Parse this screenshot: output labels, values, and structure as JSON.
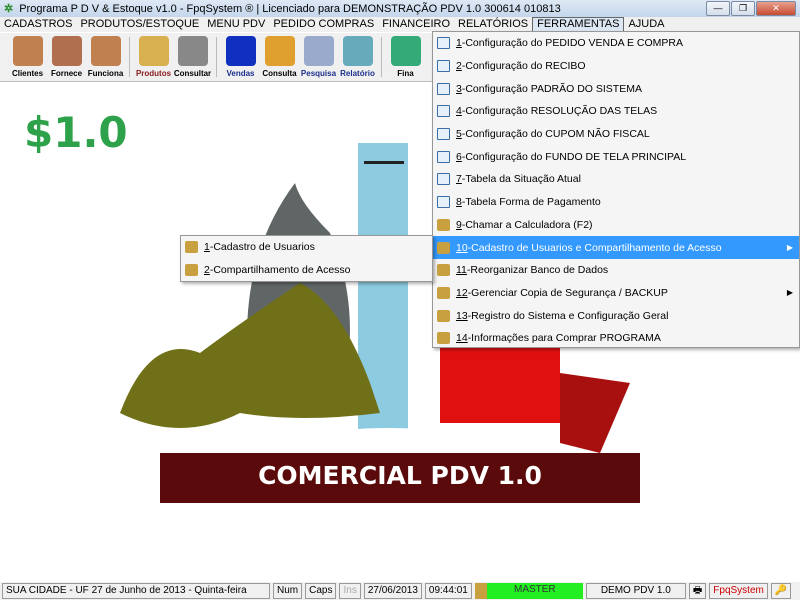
{
  "title": "Programa P D V & Estoque v1.0 - FpqSystem ® | Licenciado para  DEMONSTRAÇÃO PDV 1.0 300614 010813",
  "menubar": [
    "CADASTROS",
    "PRODUTOS/ESTOQUE",
    "MENU PDV",
    "PEDIDO COMPRAS",
    "FINANCEIRO",
    "RELATÓRIOS",
    "FERRAMENTAS",
    "AJUDA"
  ],
  "toolbar": [
    {
      "label": "Clientes",
      "icon": "clients-icon",
      "color": "#000"
    },
    {
      "label": "Fornece",
      "icon": "supplier-icon",
      "color": "#000"
    },
    {
      "label": "Funciona",
      "icon": "employee-icon",
      "color": "#000"
    },
    {
      "label": "Produtos",
      "icon": "boxes-icon",
      "color": "#8b1a1a"
    },
    {
      "label": "Consultar",
      "icon": "barcode-icon",
      "color": "#000"
    },
    {
      "label": "Vendas",
      "icon": "pdv-icon",
      "color": "#1a2f8b"
    },
    {
      "label": "Consulta",
      "icon": "drawer-icon",
      "color": "#000"
    },
    {
      "label": "Pesquisa",
      "icon": "search-icon",
      "color": "#1a2f8b"
    },
    {
      "label": "Relatório",
      "icon": "printer-icon",
      "color": "#1a2f8b"
    },
    {
      "label": "Fina",
      "icon": "money-icon",
      "color": "#000"
    }
  ],
  "logo": {
    "price": "$1.0",
    "caption": "COMERCIAL PDV 1.0"
  },
  "ferramentas_menu": [
    {
      "key": "1",
      "label": "-Configuração do PEDIDO VENDA E COMPRA"
    },
    {
      "key": "2",
      "label": "-Configuração do RECIBO"
    },
    {
      "key": "3",
      "label": "-Configuração PADRÃO DO SISTEMA"
    },
    {
      "key": "4",
      "label": "-Configuração RESOLUÇÃO DAS TELAS"
    },
    {
      "key": "5",
      "label": "-Configuração do CUPOM NÃO FISCAL"
    },
    {
      "key": "6",
      "label": "-Configuração do FUNDO DE TELA PRINCIPAL"
    },
    {
      "key": "7",
      "label": "-Tabela da Situação Atual"
    },
    {
      "key": "8",
      "label": "-Tabela Forma de Pagamento"
    },
    {
      "key": "9",
      "label": "-Chamar a Calculadora (F2)"
    },
    {
      "key": "10",
      "label": "-Cadastro de Usuarios e Compartilhamento de Acesso",
      "submenu": true,
      "highlighted": true
    },
    {
      "key": "11",
      "label": "-Reorganizar Banco de Dados"
    },
    {
      "key": "12",
      "label": "-Gerenciar Copia de Segurança / BACKUP",
      "submenu": true
    },
    {
      "key": "13",
      "label": "-Registro do Sistema e Configuração Geral"
    },
    {
      "key": "14",
      "label": "-Informações para Comprar PROGRAMA"
    }
  ],
  "submenu": [
    {
      "key": "1",
      "label": "-Cadastro de Usuarios"
    },
    {
      "key": "2",
      "label": "-Compartilhamento de Acesso"
    }
  ],
  "status": {
    "city": "SUA CIDADE - UF 27 de Junho de 2013 - Quinta-feira",
    "num": "Num",
    "caps": "Caps",
    "ins": "Ins",
    "date": "27/06/2013",
    "time": "09:44:01",
    "user": "MASTER",
    "demo": "DEMO PDV 1.0",
    "brand": "FpqSystem"
  }
}
